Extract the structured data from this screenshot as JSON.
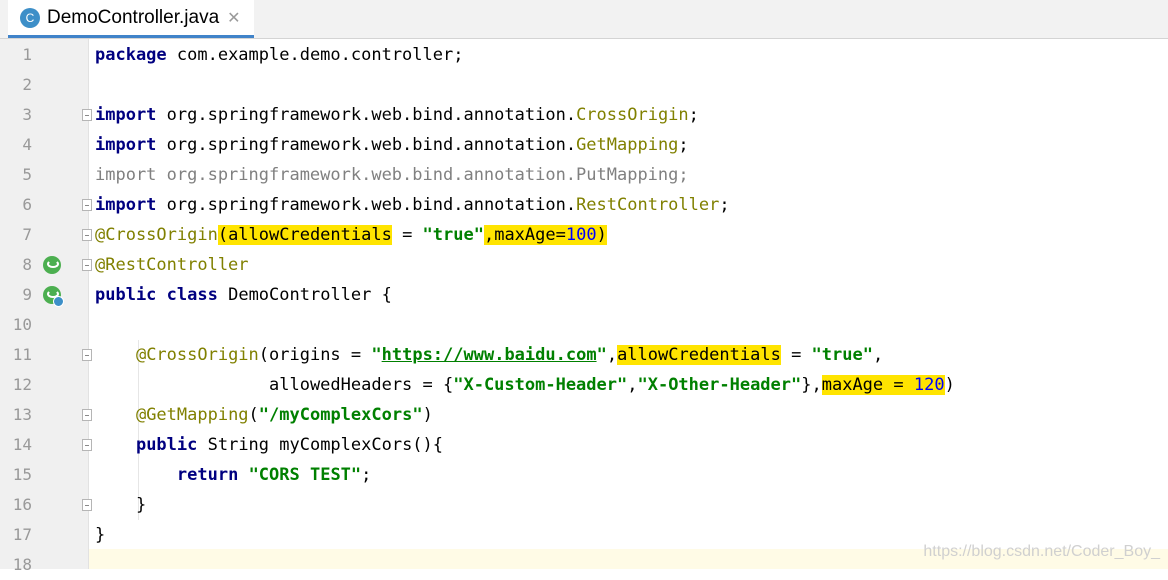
{
  "tab": {
    "icon_letter": "C",
    "title": "DemoController.java",
    "close": "✕"
  },
  "line_numbers": [
    "1",
    "2",
    "3",
    "4",
    "5",
    "6",
    "7",
    "8",
    "9",
    "10",
    "11",
    "12",
    "13",
    "14",
    "15",
    "16",
    "17",
    "18"
  ],
  "code": {
    "l1": {
      "kw": "package",
      "rest": " com.example.demo.controller;"
    },
    "l3": {
      "kw": "import",
      "pkg": " org.springframework.web.bind.annotation.",
      "cls": "CrossOrigin",
      "end": ";"
    },
    "l4": {
      "kw": "import",
      "pkg": " org.springframework.web.bind.annotation.",
      "cls": "GetMapping",
      "end": ";"
    },
    "l5": {
      "text": "import org.springframework.web.bind.annotation.PutMapping;"
    },
    "l6": {
      "kw": "import",
      "pkg": " org.springframework.web.bind.annotation.",
      "cls": "RestController",
      "end": ";"
    },
    "l7": {
      "ann": "@CrossOrigin",
      "a": "(allowCredentials",
      "b": " = ",
      "str": "\"true\"",
      "c": ",maxAge=",
      "num": "100",
      "d": ")"
    },
    "l8": {
      "ann": "@RestController"
    },
    "l9": {
      "kw1": "public",
      "sp": " ",
      "kw2": "class",
      "rest": " DemoController {"
    },
    "l11": {
      "indent": "    ",
      "ann": "@CrossOrigin",
      "a": "(origins = ",
      "q1": "\"",
      "link": "https://www.baidu.com",
      "q2": "\"",
      "b": ",",
      "hl": "allowCredentials",
      "c": " = ",
      "str": "\"true\"",
      "d": ","
    },
    "l12": {
      "indent": "                 ",
      "a": "allowedHeaders = {",
      "s1": "\"X-Custom-Header\"",
      "b": ",",
      "s2": "\"X-Other-Header\"",
      "c": "},",
      "hl": "maxAge = ",
      "num": "120",
      "d": ")"
    },
    "l13": {
      "indent": "    ",
      "ann": "@GetMapping",
      "a": "(",
      "str": "\"/myComplexCors\"",
      "b": ")"
    },
    "l14": {
      "indent": "    ",
      "kw": "public",
      "rest": " String myComplexCors(){"
    },
    "l15": {
      "indent": "        ",
      "kw": "return",
      "sp": " ",
      "str": "\"CORS TEST\"",
      "end": ";"
    },
    "l16": {
      "indent": "    ",
      "rest": "}"
    },
    "l17": {
      "rest": "}"
    }
  },
  "watermark": "https://blog.csdn.net/Coder_Boy_",
  "colors": {
    "keyword": "#000080",
    "annotation": "#808000",
    "string": "#008000",
    "number": "#0000ff",
    "highlight": "#ffe400"
  },
  "icons": [
    "java-class-icon",
    "close-icon",
    "spring-bean-icon",
    "fold-icon"
  ]
}
